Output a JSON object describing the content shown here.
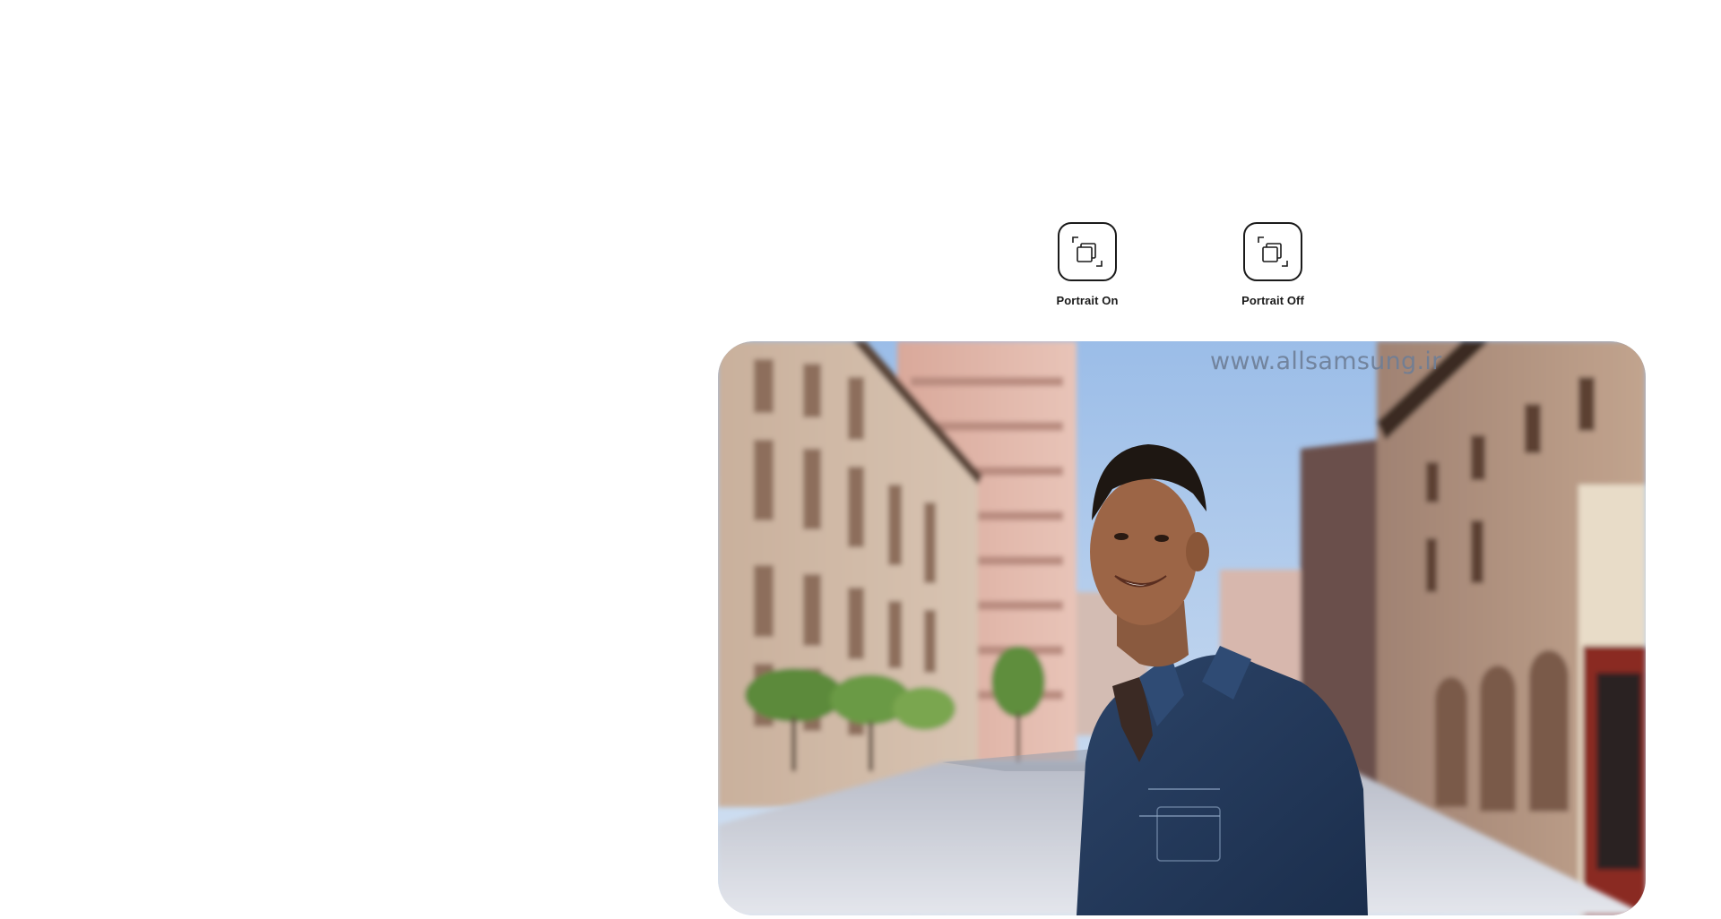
{
  "modes": {
    "portrait_on": {
      "label": "Portrait On",
      "icon": "portrait-mode-icon"
    },
    "portrait_off": {
      "label": "Portrait Off",
      "icon": "portrait-mode-icon"
    }
  },
  "photo": {
    "watermark": "www.allsamsung.ir",
    "subject": "smiling man in denim jacket on city street with blurred buildings"
  },
  "colors": {
    "button_border": "#1a1a1a",
    "label_text": "#1a1a1a",
    "watermark": "#6e7e96",
    "sky": "#a9c6ea",
    "jacket": "#233a5c"
  }
}
